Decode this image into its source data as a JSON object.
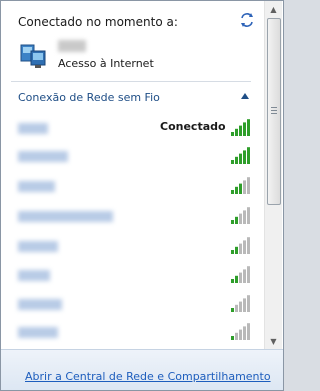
{
  "header": {
    "connected_label": "Conectado no momento a:",
    "refresh_icon": "refresh-icon"
  },
  "current_network": {
    "icon": "network-icon",
    "access_status": "Acesso à Internet"
  },
  "wireless": {
    "section_label": "Conexão de Rede sem Fio",
    "collapse_icon": "chevron-up-icon",
    "networks": [
      {
        "status": "Conectado",
        "signal_bars": 5
      },
      {
        "status": "",
        "signal_bars": 5
      },
      {
        "status": "",
        "signal_bars": 3
      },
      {
        "status": "",
        "signal_bars": 2
      },
      {
        "status": "",
        "signal_bars": 2
      },
      {
        "status": "",
        "signal_bars": 2
      },
      {
        "status": "",
        "signal_bars": 1
      },
      {
        "status": "",
        "signal_bars": 1
      }
    ]
  },
  "footer": {
    "link_label": "Abrir a Central de Rede e Compartilhamento"
  },
  "colors": {
    "signal_active": "#2e9e2a",
    "signal_inactive": "#b9b9b9",
    "link": "#1e5ebd",
    "section_label": "#1f4e86"
  }
}
